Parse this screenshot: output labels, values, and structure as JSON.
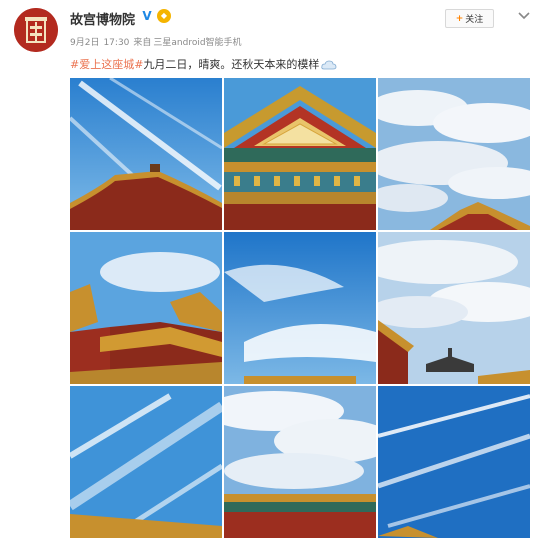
{
  "author": {
    "name": "故宫博物院",
    "verified_icon": "verified-v-icon",
    "member_icon": "vip-badge-icon"
  },
  "meta": {
    "date": "9月2日",
    "time": "17:30",
    "source_prefix": "来自",
    "source": "三星android智能手机"
  },
  "follow": {
    "label": "关注",
    "icon": "plus-icon"
  },
  "more": {
    "icon": "chevron-down-icon"
  },
  "post": {
    "hashtag": "#爱上这座城#",
    "text": "九月二日，晴爽。还秋天本来的模样",
    "weather_icon": "cloud-icon"
  },
  "images": [
    {
      "name": "photo-1",
      "content": "sky-with-contrails-and-roof-corner"
    },
    {
      "name": "photo-2",
      "content": "palace-gable-with-painted-eaves"
    },
    {
      "name": "photo-3",
      "content": "cloudy-sky-with-roof-ridge"
    },
    {
      "name": "photo-4",
      "content": "palace-roofs-under-blue-sky"
    },
    {
      "name": "photo-5",
      "content": "blue-sky-with-clouds-and-roofline"
    },
    {
      "name": "photo-6",
      "content": "cloudy-sky-with-pavilion-roof"
    },
    {
      "name": "photo-7",
      "content": "sky-with-contrails-and-roof"
    },
    {
      "name": "photo-8",
      "content": "clouds-over-gate-roof"
    },
    {
      "name": "photo-9",
      "content": "deep-blue-sky-with-contrails"
    }
  ],
  "colors": {
    "hashtag": "#eb7350",
    "follow_plus": "#ff8200",
    "avatar_bg": "#b32a1f",
    "sky_blue": "#3d8fd6"
  }
}
